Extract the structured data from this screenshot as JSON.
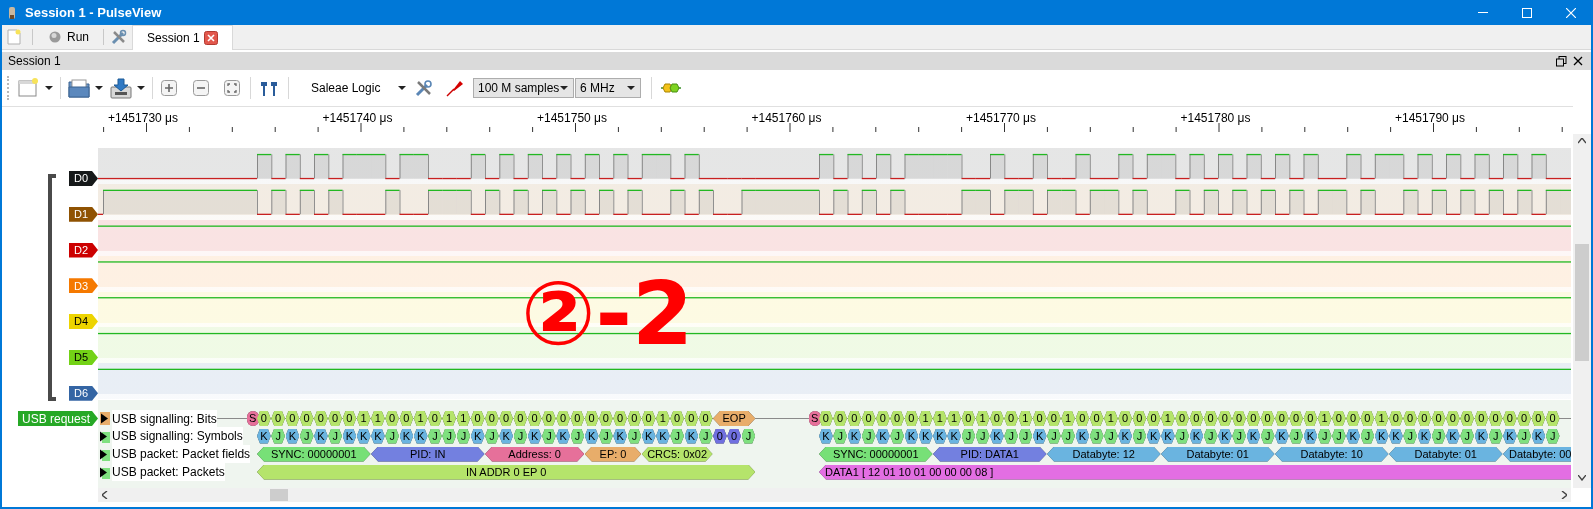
{
  "window": {
    "title": "Session 1 - PulseView"
  },
  "top_bar": {
    "run_label": "Run",
    "tabs": [
      {
        "label": "Session 1",
        "selected": true
      }
    ]
  },
  "dock": {
    "title": "Session 1"
  },
  "toolbar": {
    "device": "Saleae Logic",
    "samples": "100 M samples",
    "rate": "6 MHz"
  },
  "ruler": {
    "labels": [
      "+1451730 μs",
      "+1451740 μs",
      "+1451750 μs",
      "+1451760 μs",
      "+1451770 μs",
      "+1451780 μs",
      "+1451790 μs"
    ]
  },
  "channels": [
    {
      "name": "D0",
      "color": "#16191a"
    },
    {
      "name": "D1",
      "color": "#8f5202"
    },
    {
      "name": "D2",
      "color": "#cc0000"
    },
    {
      "name": "D3",
      "color": "#f57900"
    },
    {
      "name": "D4",
      "color": "#edd400"
    },
    {
      "name": "D5",
      "color": "#73d216"
    },
    {
      "name": "D6",
      "color": "#3465a4"
    }
  ],
  "annotation": "②-2",
  "decoder": {
    "trigger": "USB request",
    "rows": [
      {
        "label": "USB signalling: Bits",
        "packets": [
          {
            "cells": [
              {
                "text": "S",
                "color": "#e6709a"
              },
              {
                "text": "0",
                "color": "#b5e46b"
              },
              {
                "text": "0",
                "color": "#b5e46b"
              },
              {
                "text": "0",
                "color": "#b5e46b"
              },
              {
                "text": "0",
                "color": "#b5e46b"
              },
              {
                "text": "0",
                "color": "#b5e46b"
              },
              {
                "text": "0",
                "color": "#b5e46b"
              },
              {
                "text": "0",
                "color": "#b5e46b"
              },
              {
                "text": "1",
                "color": "#b5e46b"
              },
              {
                "text": "1",
                "color": "#b5e46b"
              },
              {
                "text": "0",
                "color": "#b5e46b"
              },
              {
                "text": "0",
                "color": "#b5e46b"
              },
              {
                "text": "1",
                "color": "#b5e46b"
              },
              {
                "text": "0",
                "color": "#b5e46b"
              },
              {
                "text": "1",
                "color": "#b5e46b"
              },
              {
                "text": "1",
                "color": "#b5e46b"
              },
              {
                "text": "0",
                "color": "#b5e46b"
              },
              {
                "text": "0",
                "color": "#b5e46b"
              },
              {
                "text": "0",
                "color": "#b5e46b"
              },
              {
                "text": "0",
                "color": "#b5e46b"
              },
              {
                "text": "0",
                "color": "#b5e46b"
              },
              {
                "text": "0",
                "color": "#b5e46b"
              },
              {
                "text": "0",
                "color": "#b5e46b"
              },
              {
                "text": "0",
                "color": "#b5e46b"
              },
              {
                "text": "0",
                "color": "#b5e46b"
              },
              {
                "text": "0",
                "color": "#b5e46b"
              },
              {
                "text": "0",
                "color": "#b5e46b"
              },
              {
                "text": "0",
                "color": "#b5e46b"
              },
              {
                "text": "0",
                "color": "#b5e46b"
              },
              {
                "text": "1",
                "color": "#b5e46b"
              },
              {
                "text": "0",
                "color": "#b5e46b"
              },
              {
                "text": "0",
                "color": "#b5e46b"
              },
              {
                "text": "0",
                "color": "#b5e46b"
              },
              {
                "text": "EOP",
                "color": "#e8ad6a"
              }
            ]
          },
          {
            "cells": [
              {
                "text": "S",
                "color": "#e6709a"
              },
              {
                "text": "0",
                "color": "#b5e46b"
              },
              {
                "text": "0",
                "color": "#b5e46b"
              },
              {
                "text": "0",
                "color": "#b5e46b"
              },
              {
                "text": "0",
                "color": "#b5e46b"
              },
              {
                "text": "0",
                "color": "#b5e46b"
              },
              {
                "text": "0",
                "color": "#b5e46b"
              },
              {
                "text": "0",
                "color": "#b5e46b"
              },
              {
                "text": "1",
                "color": "#b5e46b"
              },
              {
                "text": "1",
                "color": "#b5e46b"
              },
              {
                "text": "1",
                "color": "#b5e46b"
              },
              {
                "text": "0",
                "color": "#b5e46b"
              },
              {
                "text": "1",
                "color": "#b5e46b"
              },
              {
                "text": "0",
                "color": "#b5e46b"
              },
              {
                "text": "0",
                "color": "#b5e46b"
              },
              {
                "text": "1",
                "color": "#b5e46b"
              },
              {
                "text": "0",
                "color": "#b5e46b"
              },
              {
                "text": "0",
                "color": "#b5e46b"
              },
              {
                "text": "1",
                "color": "#b5e46b"
              },
              {
                "text": "0",
                "color": "#b5e46b"
              },
              {
                "text": "0",
                "color": "#b5e46b"
              },
              {
                "text": "1",
                "color": "#b5e46b"
              },
              {
                "text": "0",
                "color": "#b5e46b"
              },
              {
                "text": "0",
                "color": "#b5e46b"
              },
              {
                "text": "0",
                "color": "#b5e46b"
              },
              {
                "text": "1",
                "color": "#b5e46b"
              },
              {
                "text": "0",
                "color": "#b5e46b"
              },
              {
                "text": "0",
                "color": "#b5e46b"
              },
              {
                "text": "0",
                "color": "#b5e46b"
              },
              {
                "text": "0",
                "color": "#b5e46b"
              },
              {
                "text": "0",
                "color": "#b5e46b"
              },
              {
                "text": "0",
                "color": "#b5e46b"
              },
              {
                "text": "0",
                "color": "#b5e46b"
              },
              {
                "text": "0",
                "color": "#b5e46b"
              },
              {
                "text": "0",
                "color": "#b5e46b"
              },
              {
                "text": "0",
                "color": "#b5e46b"
              },
              {
                "text": "1",
                "color": "#b5e46b"
              },
              {
                "text": "0",
                "color": "#b5e46b"
              },
              {
                "text": "0",
                "color": "#b5e46b"
              },
              {
                "text": "0",
                "color": "#b5e46b"
              },
              {
                "text": "1",
                "color": "#b5e46b"
              },
              {
                "text": "0",
                "color": "#b5e46b"
              },
              {
                "text": "0",
                "color": "#b5e46b"
              },
              {
                "text": "0",
                "color": "#b5e46b"
              },
              {
                "text": "0",
                "color": "#b5e46b"
              },
              {
                "text": "0",
                "color": "#b5e46b"
              },
              {
                "text": "0",
                "color": "#b5e46b"
              },
              {
                "text": "0",
                "color": "#b5e46b"
              },
              {
                "text": "0",
                "color": "#b5e46b"
              },
              {
                "text": "0",
                "color": "#b5e46b"
              },
              {
                "text": "0",
                "color": "#b5e46b"
              },
              {
                "text": "0",
                "color": "#b5e46b"
              },
              {
                "text": "0",
                "color": "#b5e46b"
              }
            ]
          }
        ]
      },
      {
        "label": "USB signalling: Symbols",
        "packets": [
          {
            "cells": [
              {
                "text": "K",
                "kind": "k",
                "color": "#6ab4e0"
              },
              {
                "text": "J",
                "kind": "j",
                "color": "#7fe07f"
              },
              {
                "text": "K",
                "kind": "k",
                "color": "#6ab4e0"
              },
              {
                "text": "J",
                "kind": "j",
                "color": "#7fe07f"
              },
              {
                "text": "K",
                "kind": "k",
                "color": "#6ab4e0"
              },
              {
                "text": "J",
                "kind": "j",
                "color": "#7fe07f"
              },
              {
                "text": "K",
                "kind": "k",
                "color": "#6ab4e0"
              },
              {
                "text": "K",
                "kind": "k",
                "color": "#6ab4e0"
              },
              {
                "text": "K",
                "kind": "k",
                "color": "#6ab4e0"
              },
              {
                "text": "J",
                "kind": "j",
                "color": "#7fe07f"
              },
              {
                "text": "K",
                "kind": "k",
                "color": "#6ab4e0"
              },
              {
                "text": "K",
                "kind": "k",
                "color": "#6ab4e0"
              },
              {
                "text": "J",
                "kind": "j",
                "color": "#7fe07f"
              },
              {
                "text": "J",
                "kind": "j",
                "color": "#7fe07f"
              },
              {
                "text": "J",
                "kind": "j",
                "color": "#7fe07f"
              },
              {
                "text": "K",
                "kind": "k",
                "color": "#6ab4e0"
              },
              {
                "text": "J",
                "kind": "j",
                "color": "#7fe07f"
              },
              {
                "text": "K",
                "kind": "k",
                "color": "#6ab4e0"
              },
              {
                "text": "J",
                "kind": "j",
                "color": "#7fe07f"
              },
              {
                "text": "K",
                "kind": "k",
                "color": "#6ab4e0"
              },
              {
                "text": "J",
                "kind": "j",
                "color": "#7fe07f"
              },
              {
                "text": "K",
                "kind": "k",
                "color": "#6ab4e0"
              },
              {
                "text": "J",
                "kind": "j",
                "color": "#7fe07f"
              },
              {
                "text": "K",
                "kind": "k",
                "color": "#6ab4e0"
              },
              {
                "text": "J",
                "kind": "j",
                "color": "#7fe07f"
              },
              {
                "text": "K",
                "kind": "k",
                "color": "#6ab4e0"
              },
              {
                "text": "J",
                "kind": "j",
                "color": "#7fe07f"
              },
              {
                "text": "K",
                "kind": "k",
                "color": "#6ab4e0"
              },
              {
                "text": "K",
                "kind": "k",
                "color": "#6ab4e0"
              },
              {
                "text": "J",
                "kind": "j",
                "color": "#7fe07f"
              },
              {
                "text": "K",
                "kind": "k",
                "color": "#6ab4e0"
              },
              {
                "text": "J",
                "kind": "j",
                "color": "#7fe07f"
              },
              {
                "text": "0",
                "kind": "se0",
                "color": "#7070e0"
              },
              {
                "text": "0",
                "kind": "se0",
                "color": "#7070e0"
              },
              {
                "text": "J",
                "kind": "j",
                "color": "#7fe07f"
              }
            ]
          },
          {
            "cells": [
              {
                "text": "K",
                "kind": "k",
                "color": "#6ab4e0"
              },
              {
                "text": "J",
                "kind": "j",
                "color": "#7fe07f"
              },
              {
                "text": "K",
                "kind": "k",
                "color": "#6ab4e0"
              },
              {
                "text": "J",
                "kind": "j",
                "color": "#7fe07f"
              },
              {
                "text": "K",
                "kind": "k",
                "color": "#6ab4e0"
              },
              {
                "text": "J",
                "kind": "j",
                "color": "#7fe07f"
              },
              {
                "text": "K",
                "kind": "k",
                "color": "#6ab4e0"
              },
              {
                "text": "K",
                "kind": "k",
                "color": "#6ab4e0"
              },
              {
                "text": "K",
                "kind": "k",
                "color": "#6ab4e0"
              },
              {
                "text": "K",
                "kind": "k",
                "color": "#6ab4e0"
              },
              {
                "text": "J",
                "kind": "j",
                "color": "#7fe07f"
              },
              {
                "text": "J",
                "kind": "j",
                "color": "#7fe07f"
              },
              {
                "text": "K",
                "kind": "k",
                "color": "#6ab4e0"
              },
              {
                "text": "J",
                "kind": "j",
                "color": "#7fe07f"
              },
              {
                "text": "J",
                "kind": "j",
                "color": "#7fe07f"
              },
              {
                "text": "K",
                "kind": "k",
                "color": "#6ab4e0"
              },
              {
                "text": "J",
                "kind": "j",
                "color": "#7fe07f"
              },
              {
                "text": "J",
                "kind": "j",
                "color": "#7fe07f"
              },
              {
                "text": "K",
                "kind": "k",
                "color": "#6ab4e0"
              },
              {
                "text": "J",
                "kind": "j",
                "color": "#7fe07f"
              },
              {
                "text": "J",
                "kind": "j",
                "color": "#7fe07f"
              },
              {
                "text": "K",
                "kind": "k",
                "color": "#6ab4e0"
              },
              {
                "text": "J",
                "kind": "j",
                "color": "#7fe07f"
              },
              {
                "text": "K",
                "kind": "k",
                "color": "#6ab4e0"
              },
              {
                "text": "K",
                "kind": "k",
                "color": "#6ab4e0"
              },
              {
                "text": "J",
                "kind": "j",
                "color": "#7fe07f"
              },
              {
                "text": "K",
                "kind": "k",
                "color": "#6ab4e0"
              },
              {
                "text": "J",
                "kind": "j",
                "color": "#7fe07f"
              },
              {
                "text": "K",
                "kind": "k",
                "color": "#6ab4e0"
              },
              {
                "text": "J",
                "kind": "j",
                "color": "#7fe07f"
              },
              {
                "text": "K",
                "kind": "k",
                "color": "#6ab4e0"
              },
              {
                "text": "J",
                "kind": "j",
                "color": "#7fe07f"
              },
              {
                "text": "K",
                "kind": "k",
                "color": "#6ab4e0"
              },
              {
                "text": "J",
                "kind": "j",
                "color": "#7fe07f"
              },
              {
                "text": "K",
                "kind": "k",
                "color": "#6ab4e0"
              },
              {
                "text": "J",
                "kind": "j",
                "color": "#7fe07f"
              },
              {
                "text": "J",
                "kind": "j",
                "color": "#7fe07f"
              },
              {
                "text": "K",
                "kind": "k",
                "color": "#6ab4e0"
              },
              {
                "text": "J",
                "kind": "j",
                "color": "#7fe07f"
              },
              {
                "text": "K",
                "kind": "k",
                "color": "#6ab4e0"
              },
              {
                "text": "K",
                "kind": "k",
                "color": "#6ab4e0"
              },
              {
                "text": "J",
                "kind": "j",
                "color": "#7fe07f"
              },
              {
                "text": "K",
                "kind": "k",
                "color": "#6ab4e0"
              },
              {
                "text": "J",
                "kind": "j",
                "color": "#7fe07f"
              },
              {
                "text": "K",
                "kind": "k",
                "color": "#6ab4e0"
              },
              {
                "text": "J",
                "kind": "j",
                "color": "#7fe07f"
              },
              {
                "text": "K",
                "kind": "k",
                "color": "#6ab4e0"
              },
              {
                "text": "J",
                "kind": "j",
                "color": "#7fe07f"
              },
              {
                "text": "K",
                "kind": "k",
                "color": "#6ab4e0"
              },
              {
                "text": "J",
                "kind": "j",
                "color": "#7fe07f"
              },
              {
                "text": "K",
                "kind": "k",
                "color": "#6ab4e0"
              },
              {
                "text": "J",
                "kind": "j",
                "color": "#7fe07f"
              }
            ]
          }
        ]
      },
      {
        "label": "USB packet: Packet fields",
        "packets": [
          {
            "cells": [
              {
                "text": "SYNC: 00000001",
                "color": "#77e077"
              },
              {
                "text": "PID: IN",
                "color": "#7380e0"
              },
              {
                "text": "Address: 0",
                "color": "#e6709a"
              },
              {
                "text": "EP: 0",
                "color": "#e8ad6a"
              },
              {
                "text": "CRC5: 0x02",
                "color": "#b5e46b"
              }
            ]
          },
          {
            "cells": [
              {
                "text": "SYNC: 00000001",
                "color": "#77e077"
              },
              {
                "text": "PID: DATA1",
                "color": "#7380e0"
              },
              {
                "text": "Databyte: 12",
                "color": "#6ab4e0"
              },
              {
                "text": "Databyte: 01",
                "color": "#6ab4e0"
              },
              {
                "text": "Databyte: 10",
                "color": "#6ab4e0"
              },
              {
                "text": "Databyte: 01",
                "color": "#6ab4e0"
              },
              {
                "text": "Databyte: 00",
                "color": "#6ab4e0"
              }
            ]
          }
        ]
      },
      {
        "label": "USB packet: Packets",
        "packets": [
          {
            "cells": [
              {
                "text": "IN ADDR 0 EP 0",
                "color": "#b5e46b"
              }
            ]
          },
          {
            "cells": [
              {
                "text": "DATA1 [ 12 01 10 01 00 00 00 08 ]",
                "color": "#e36ee3"
              }
            ]
          }
        ]
      }
    ]
  }
}
